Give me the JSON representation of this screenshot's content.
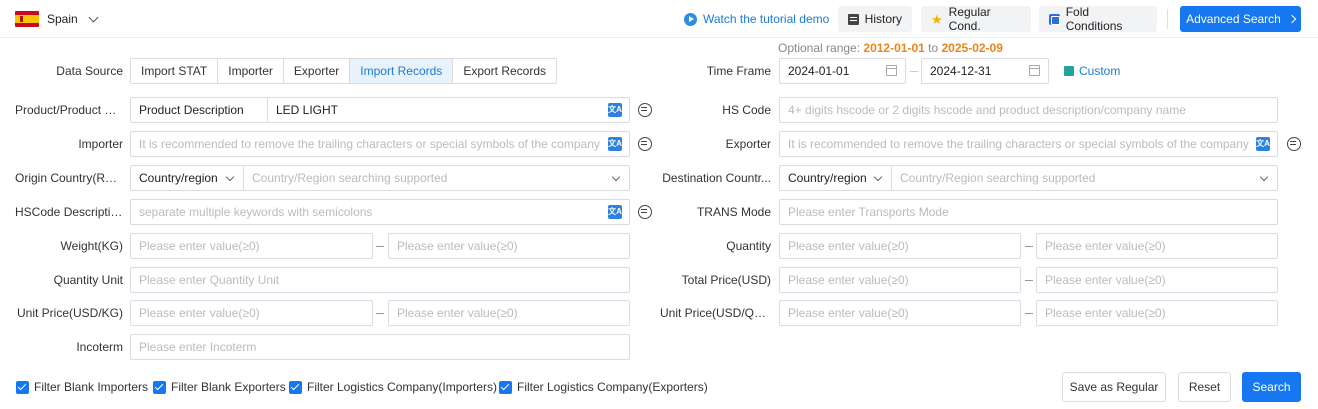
{
  "header": {
    "country": "Spain",
    "tutorial": "Watch the tutorial demo",
    "history": "History",
    "regular_cond": "Regular Cond.",
    "fold_conditions": "Fold Conditions",
    "advanced_search": "Advanced Search"
  },
  "optional_range": {
    "label": "Optional range:",
    "start": "2012-01-01",
    "to": "to",
    "end": "2025-02-09"
  },
  "data_source": {
    "label": "Data Source",
    "options": [
      "Import STAT",
      "Importer",
      "Exporter",
      "Import Records",
      "Export Records"
    ],
    "selected": "Import Records"
  },
  "time_frame": {
    "label": "Time Frame",
    "start": "2024-01-01",
    "end": "2024-12-31",
    "custom": "Custom"
  },
  "left": {
    "product": {
      "label": "Product/Product D...",
      "type": "Product Description",
      "value": "LED LIGHT"
    },
    "importer": {
      "label": "Importer",
      "placeholder": "It is recommended to remove the trailing characters or special symbols of the company"
    },
    "origin": {
      "label": "Origin Country(Regi...",
      "type": "Country/region",
      "placeholder": "Country/Region searching supported"
    },
    "hscode_desc": {
      "label": "HSCode Descriptio...",
      "placeholder": "separate multiple keywords with semicolons"
    },
    "weight": {
      "label": "Weight(KG)",
      "placeholder_min": "Please enter value(≥0)",
      "placeholder_max": "Please enter value(≥0)"
    },
    "quantity_unit": {
      "label": "Quantity Unit",
      "placeholder": "Please enter Quantity Unit"
    },
    "unit_price_kg": {
      "label": "Unit Price(USD/KG)",
      "placeholder_min": "Please enter value(≥0)",
      "placeholder_max": "Please enter value(≥0)"
    },
    "incoterm": {
      "label": "Incoterm",
      "placeholder": "Please enter Incoterm"
    }
  },
  "right": {
    "hs_code": {
      "label": "HS Code",
      "placeholder": "4+ digits hscode or 2 digits hscode and product description/company name"
    },
    "exporter": {
      "label": "Exporter",
      "placeholder": "It is recommended to remove the trailing characters or special symbols of the company"
    },
    "destination": {
      "label": "Destination Countr...",
      "type": "Country/region",
      "placeholder": "Country/Region searching supported"
    },
    "trans_mode": {
      "label": "TRANS Mode",
      "placeholder": "Please enter Transports Mode"
    },
    "quantity": {
      "label": "Quantity",
      "placeholder_min": "Please enter value(≥0)",
      "placeholder_max": "Please enter value(≥0)"
    },
    "total_price": {
      "label": "Total Price(USD)",
      "placeholder_min": "Please enter value(≥0)",
      "placeholder_max": "Please enter value(≥0)"
    },
    "unit_price_qty": {
      "label": "Unit Price(USD/QTY)",
      "placeholder_min": "Please enter value(≥0)",
      "placeholder_max": "Please enter value(≥0)"
    }
  },
  "filters": [
    {
      "label": "Filter Blank Importers",
      "checked": true
    },
    {
      "label": "Filter Blank Exporters",
      "checked": true
    },
    {
      "label": "Filter Logistics Company(Importers)",
      "checked": true
    },
    {
      "label": "Filter Logistics Company(Exporters)",
      "checked": true
    }
  ],
  "actions": {
    "save_regular": "Save as Regular",
    "reset": "Reset",
    "search": "Search"
  },
  "icons": {
    "translate": "文A"
  },
  "colors": {
    "primary": "#1677f0",
    "link": "#1a7bd6",
    "date_highlight": "#e8861a"
  }
}
